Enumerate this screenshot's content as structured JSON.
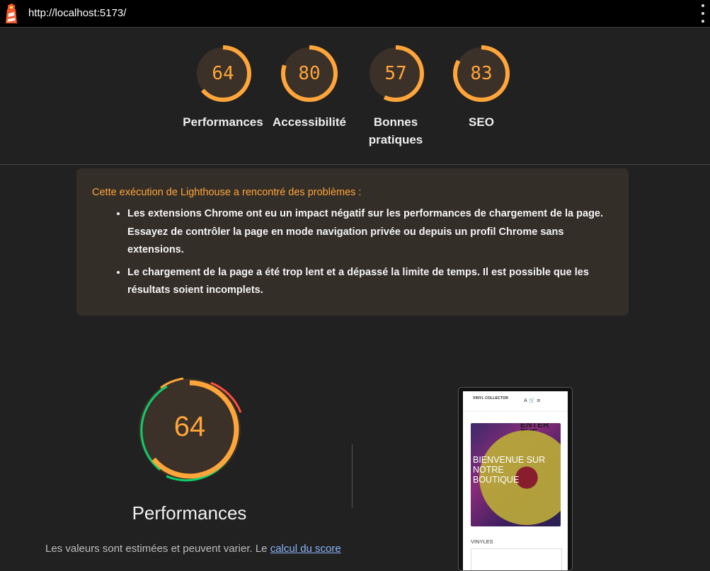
{
  "browser": {
    "url": "http://localhost:5173/"
  },
  "scores": [
    {
      "value": "64",
      "label": "Performances",
      "fraction": 0.64,
      "color": "#ffa53a"
    },
    {
      "value": "80",
      "label": "Accessibilité",
      "fraction": 0.8,
      "color": "#ffa53a"
    },
    {
      "value": "57",
      "label": "Bonnes pratiques",
      "fraction": 0.57,
      "color": "#ffa53a"
    },
    {
      "value": "83",
      "label": "SEO",
      "fraction": 0.83,
      "color": "#ffa53a"
    }
  ],
  "warning": {
    "heading": "Cette exécution de Lighthouse a rencontré des problèmes :",
    "items": [
      "Les extensions Chrome ont eu un impact négatif sur les performances de chargement de la page. Essayez de contrôler la page en mode navigation privée ou depuis un profil Chrome sans extensions.",
      "Le chargement de la page a été trop lent et a dépassé la limite de temps. Il est possible que les résultats soient incomplets."
    ]
  },
  "performance": {
    "score": "64",
    "fraction": 0.64,
    "title": "Performances",
    "description_prefix": "Les valeurs sont estimées et peuvent varier. Le ",
    "link_text": "calcul du score"
  },
  "preview": {
    "logo": "VINYL COLLECTOR",
    "icons": "A  🛒  ≡",
    "hero_text": "BIENVENUE SUR NOTRE BOUTIQUE",
    "bg_word": "ENTER THE",
    "section_label": "VINYLES"
  },
  "colors": {
    "average": "#ffa53a",
    "good": "#0cce6b",
    "poor": "#ff4e42",
    "background": "#212121"
  }
}
